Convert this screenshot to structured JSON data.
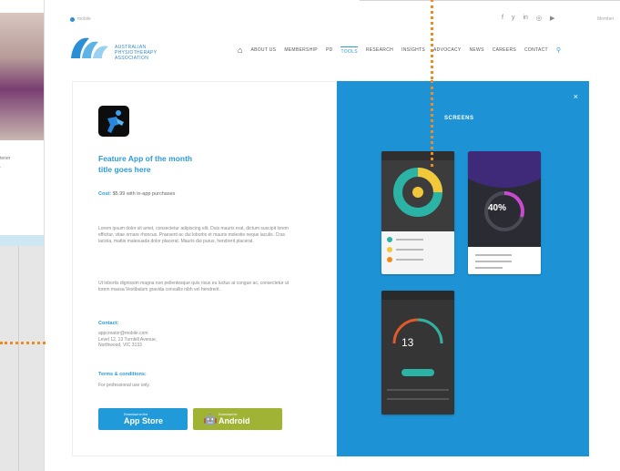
{
  "topbar": {
    "left_link": "mobile",
    "right_link": "Member",
    "socials": [
      "f",
      "y",
      "in",
      "◎",
      "▶"
    ]
  },
  "logo": {
    "line1": "AUSTRALIAN",
    "line2": "PHYSIOTHERAPY",
    "line3": "ASSOCIATION"
  },
  "nav": {
    "items": [
      "ABOUT US",
      "MEMBERSHIP",
      "PD",
      "TOOLS",
      "RESEARCH",
      "INSIGHTS",
      "ADVOCACY",
      "NEWS",
      "CAREERS",
      "CONTACT"
    ],
    "active_index": 3
  },
  "app": {
    "title": "Feature App of the month\ntitle goes here",
    "cost_label": "Cost:",
    "cost_value": "$5.99 with in-app purchases",
    "para1": "Lorem ipsum dolor sit amet, consectetur adipiscing elit. Duis mauris erat, dictum suscipit lorem efficitur, vitae ornare rhoncus. Praesent ac dui lobortis et mauris molestie neque iaculis. Cras lacinia, mattis malesuada dolor placerat. Mauris dui purus, hendrerit placerat.",
    "para2": "Ut lobortis dignissim magna non pellentesque quis risus eu luctus at congue ac, consectetur ut lorem massa Vestibulum gravida convallis nibh vel hendrerit.",
    "contact_heading": "Contact:",
    "contact_text": "appcreator@mobile.com\nLevel 12, 13 Turnbill Avenue,\nNorthwood, VIC 3133",
    "terms_heading": "Terms & conditions:",
    "terms_text": "For professional use only.",
    "apple_small": "Download on the",
    "apple_big": "App Store",
    "android_small": "Download for",
    "android_big": "Android"
  },
  "screens": {
    "label": "SCREENS",
    "close": "×",
    "percent_text": "40%",
    "timer_text": "13"
  },
  "colors": {
    "brand_blue": "#1d93d6",
    "android_green": "#a0b334",
    "accent_orange": "#f08c1e"
  }
}
